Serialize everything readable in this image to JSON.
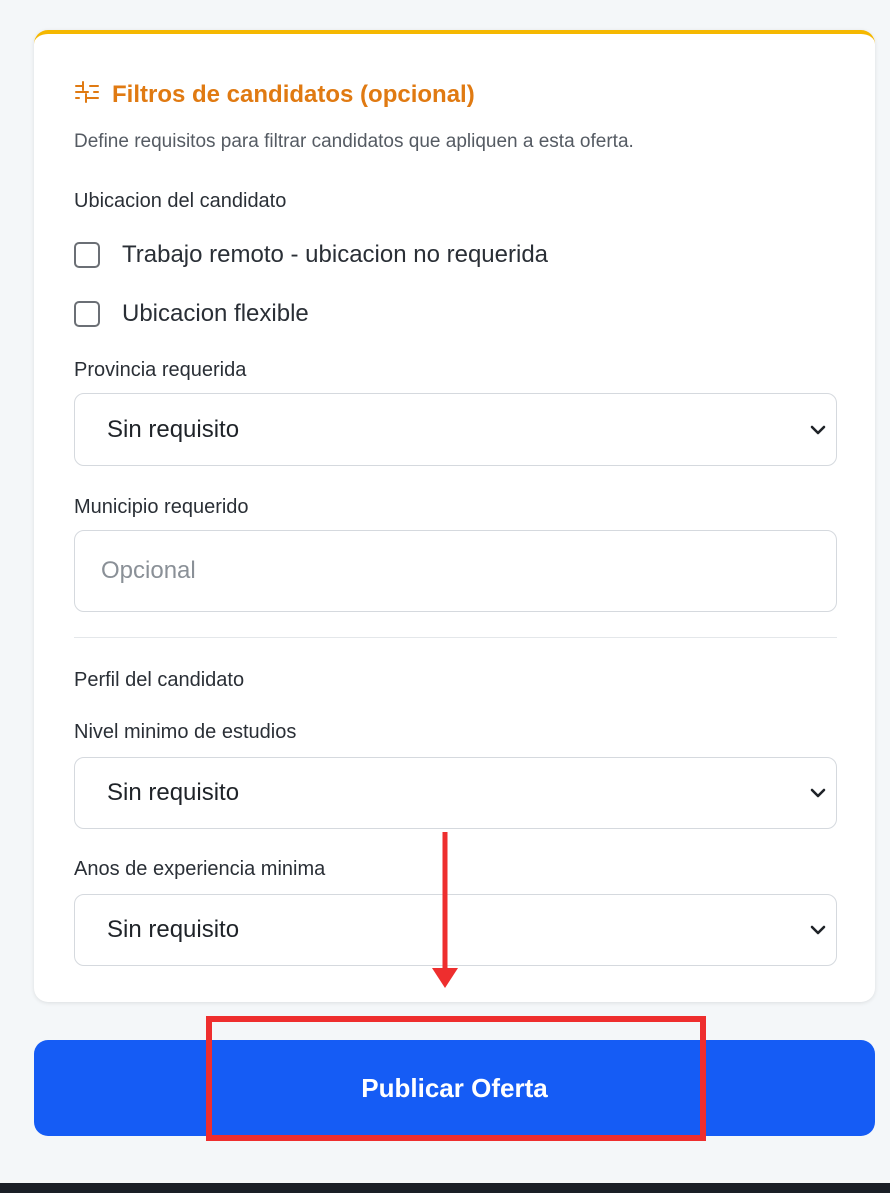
{
  "filters_card": {
    "icon": "sliders-icon",
    "title": "Filtros de candidatos (opcional)",
    "description": "Define requisitos para filtrar candidatos que apliquen a esta oferta.",
    "location_section": {
      "heading": "Ubicacion del candidato",
      "remote_checkbox": {
        "label": "Trabajo remoto - ubicacion no requerida",
        "checked": false
      },
      "flexible_checkbox": {
        "label": "Ubicacion flexible",
        "checked": false
      },
      "province": {
        "label": "Provincia requerida",
        "value": "Sin requisito"
      },
      "municipality": {
        "label": "Municipio requerido",
        "value": "",
        "placeholder": "Opcional"
      }
    },
    "profile_section": {
      "heading": "Perfil del candidato",
      "education": {
        "label": "Nivel minimo de estudios",
        "value": "Sin requisito"
      },
      "experience": {
        "label": "Anos de experiencia minima",
        "value": "Sin requisito"
      }
    }
  },
  "publish_button": {
    "label": "Publicar Oferta"
  },
  "colors": {
    "accent_orange": "#e07a12",
    "card_top_border": "#f5b800",
    "primary_blue": "#155cf5",
    "annotation_red": "#ee2e2e"
  }
}
